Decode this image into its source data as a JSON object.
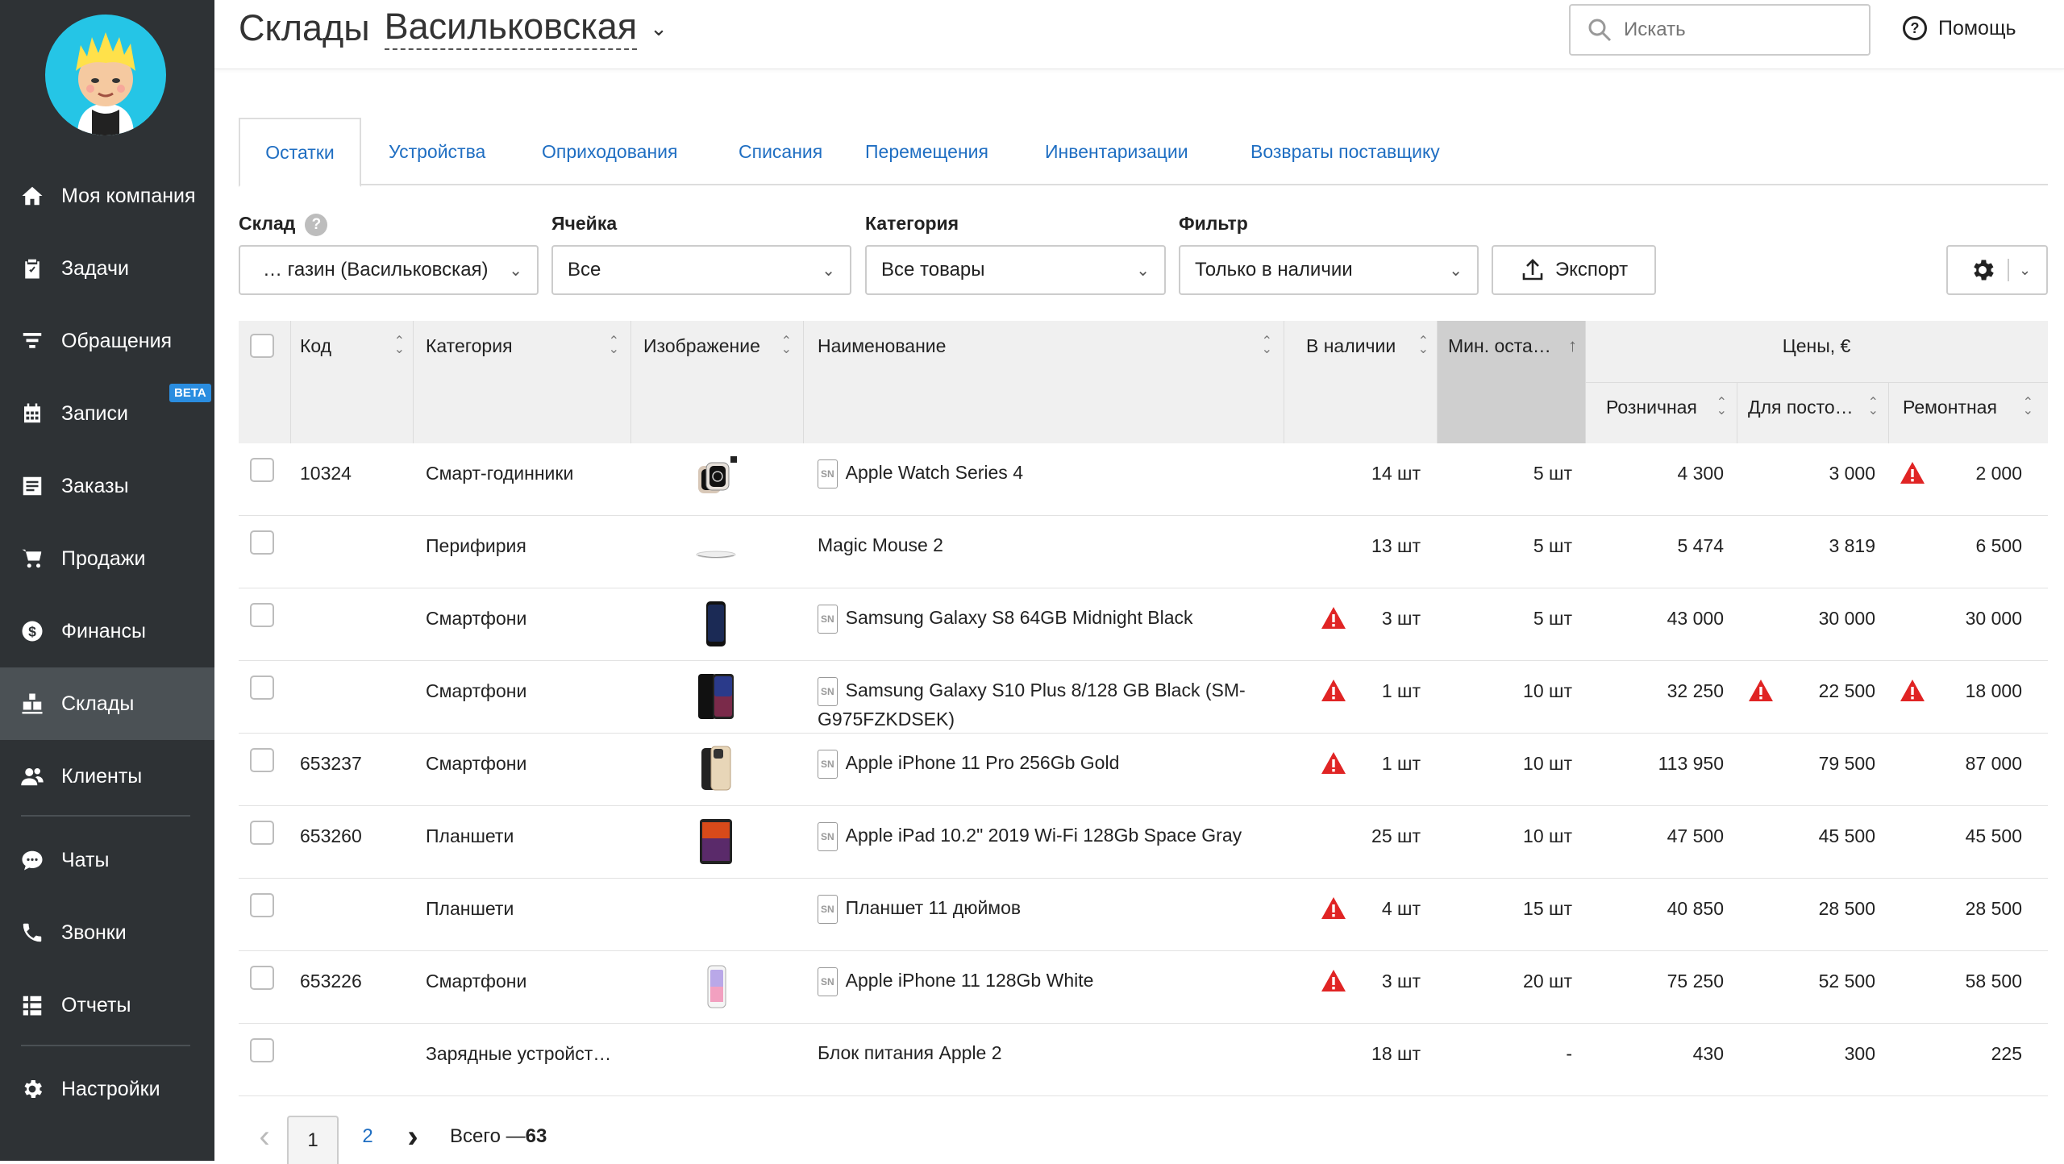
{
  "sidebar": {
    "items": [
      {
        "label": "Моя компания",
        "icon": "home-icon"
      },
      {
        "label": "Задачи",
        "icon": "clipboard-icon"
      },
      {
        "label": "Обращения",
        "icon": "funnel-icon"
      },
      {
        "label": "Записи",
        "icon": "calendar-icon",
        "badge": "BETA"
      },
      {
        "label": "Заказы",
        "icon": "orders-icon"
      },
      {
        "label": "Продажи",
        "icon": "cart-icon"
      },
      {
        "label": "Финансы",
        "icon": "dollar-icon"
      },
      {
        "label": "Склады",
        "icon": "boxes-icon",
        "active": true
      },
      {
        "label": "Клиенты",
        "icon": "users-icon"
      },
      {
        "label": "Чаты",
        "icon": "chat-icon"
      },
      {
        "label": "Звонки",
        "icon": "phone-icon"
      },
      {
        "label": "Отчеты",
        "icon": "reports-icon"
      },
      {
        "label": "Настройки",
        "icon": "gear-icon"
      }
    ]
  },
  "header": {
    "title": "Склады",
    "location": "Васильковская",
    "search_placeholder": "Искать",
    "help_label": "Помощь"
  },
  "tabs": [
    "Остатки",
    "Устройства",
    "Оприходования",
    "Списания",
    "Перемещения",
    "Инвентаризации",
    "Возвраты поставщику"
  ],
  "filters": {
    "warehouse_label": "Склад",
    "warehouse_value": "… газин (Васильковская)",
    "cell_label": "Ячейка",
    "cell_value": "Все",
    "category_label": "Категория",
    "category_value": "Все товары",
    "filter_label": "Фильтр",
    "filter_value": "Только в наличии",
    "export_label": "Экспорт"
  },
  "table": {
    "headers": {
      "code": "Код",
      "category": "Категория",
      "image": "Изображение",
      "name": "Наименование",
      "stock": "В наличии",
      "min": "Мин. оста…",
      "prices": "Цены, €",
      "retail": "Розничная",
      "regular": "Для посто…",
      "repair": "Ремонтная"
    },
    "rows": [
      {
        "code": "10324",
        "category": "Смарт-годинники",
        "thumb": "watch",
        "sn": true,
        "name": "Apple Watch Series 4",
        "name2": "",
        "stock": "14 шт",
        "stock_warn": false,
        "min": "5 шт",
        "retail": "4 300",
        "retail_warn": false,
        "regular": "3 000",
        "regular_warn": true,
        "repair": "2 000"
      },
      {
        "code": "",
        "category": "Перифирия",
        "thumb": "mouse",
        "sn": false,
        "name": "Magic Mouse 2",
        "name2": "",
        "stock": "13 шт",
        "stock_warn": false,
        "min": "5 шт",
        "retail": "5 474",
        "retail_warn": false,
        "regular": "3 819",
        "regular_warn": false,
        "repair": "6 500"
      },
      {
        "code": "",
        "category": "Смартфони",
        "thumb": "phone-dark",
        "sn": true,
        "name": "Samsung Galaxy S8 64GB Midnight Black",
        "name2": "",
        "stock": "3 шт",
        "stock_warn": true,
        "min": "5 шт",
        "retail": "43 000",
        "retail_warn": false,
        "regular": "30 000",
        "regular_warn": false,
        "repair": "30 000"
      },
      {
        "code": "",
        "category": "Смартфони",
        "thumb": "phone-pair",
        "sn": true,
        "name": "Samsung Galaxy S10 Plus 8/128 GB Black (SM-",
        "name2": "G975FZKDSEK)",
        "stock": "1 шт",
        "stock_warn": true,
        "min": "10 шт",
        "retail": "32 250",
        "retail_warn": true,
        "regular": "22 500",
        "regular_warn": true,
        "repair": "18 000"
      },
      {
        "code": "653237",
        "category": "Смартфони",
        "thumb": "phone-gold",
        "sn": true,
        "name": "Apple iPhone 11 Pro 256Gb Gold",
        "name2": "",
        "stock": "1 шт",
        "stock_warn": true,
        "min": "10 шт",
        "retail": "113 950",
        "retail_warn": false,
        "regular": "79 500",
        "regular_warn": false,
        "repair": "87 000"
      },
      {
        "code": "653260",
        "category": "Планшети",
        "thumb": "tablet",
        "sn": true,
        "name": "Apple iPad 10.2\" 2019 Wi-Fi 128Gb Space Gray",
        "name2": "",
        "stock": "25 шт",
        "stock_warn": false,
        "min": "10 шт",
        "retail": "47 500",
        "retail_warn": false,
        "regular": "45 500",
        "regular_warn": false,
        "repair": "45 500"
      },
      {
        "code": "",
        "category": "Планшети",
        "thumb": "",
        "sn": true,
        "name": "Планшет 11 дюймов",
        "name2": "",
        "stock": "4 шт",
        "stock_warn": true,
        "min": "15 шт",
        "retail": "40 850",
        "retail_warn": false,
        "regular": "28 500",
        "regular_warn": false,
        "repair": "28 500"
      },
      {
        "code": "653226",
        "category": "Смартфони",
        "thumb": "phone-white",
        "sn": true,
        "name": "Apple iPhone 11 128Gb White",
        "name2": "",
        "stock": "3 шт",
        "stock_warn": true,
        "min": "20 шт",
        "retail": "75 250",
        "retail_warn": false,
        "regular": "52 500",
        "regular_warn": false,
        "repair": "58 500"
      },
      {
        "code": "",
        "category": "Зарядные устройст…",
        "thumb": "",
        "sn": false,
        "name": "Блок питания Apple 2",
        "name2": "",
        "stock": "18 шт",
        "stock_warn": false,
        "min": "-",
        "retail": "430",
        "retail_warn": false,
        "regular": "300",
        "regular_warn": false,
        "repair": "225"
      }
    ]
  },
  "pagination": {
    "pages": [
      "1",
      "2"
    ],
    "current": "1",
    "total_text": "Всего — ",
    "total_value": "63"
  },
  "colors": {
    "sidebar_bg": "#2e3235",
    "sidebar_active": "#4b5155",
    "link": "#1f6ec2",
    "warning": "#e02424",
    "avatar_bg": "#25c5e6"
  }
}
